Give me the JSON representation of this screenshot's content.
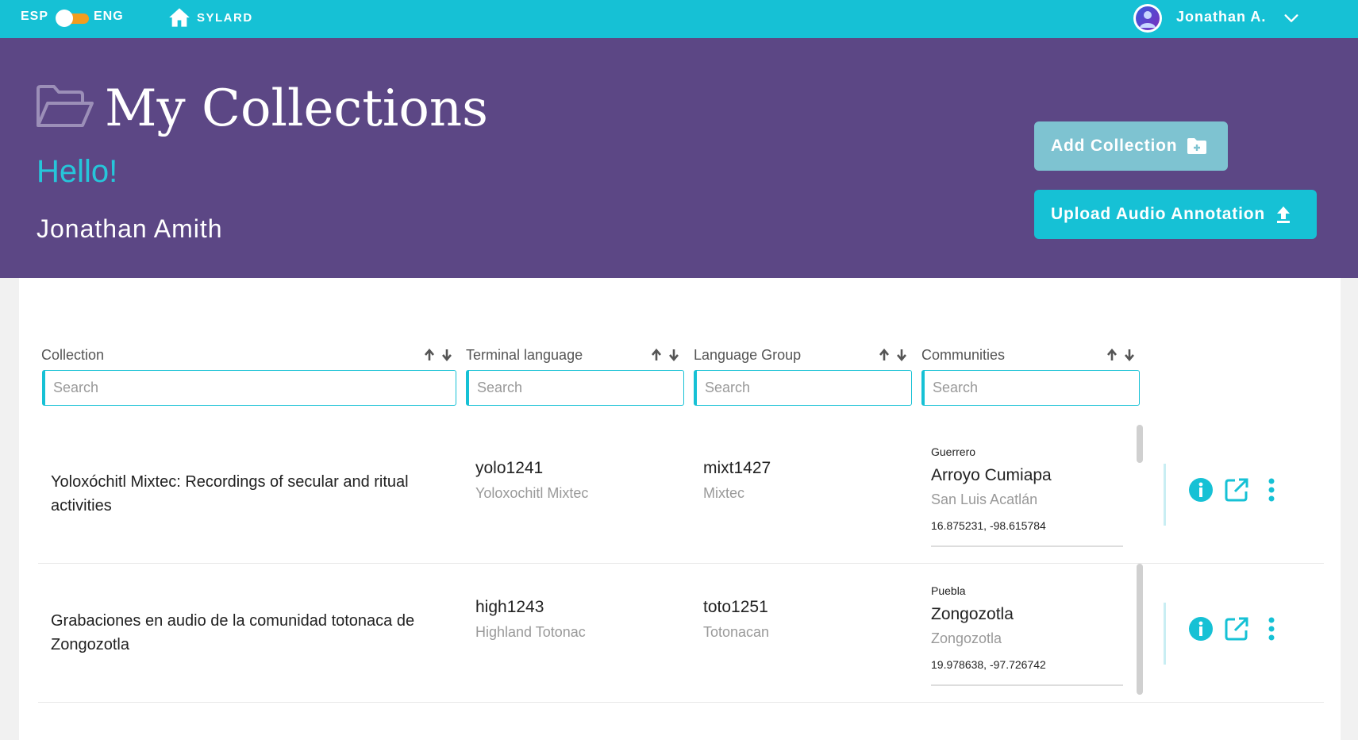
{
  "topbar": {
    "lang_left": "ESP",
    "lang_right": "ENG",
    "brand": "SYLARD",
    "user": "Jonathan A."
  },
  "hero": {
    "title": "My Collections",
    "greeting": "Hello!",
    "full_name": "Jonathan Amith",
    "add_button": "Add Collection",
    "upload_button": "Upload Audio Annotation"
  },
  "columns": [
    {
      "label": "Collection",
      "placeholder": "Search"
    },
    {
      "label": "Terminal language",
      "placeholder": "Search"
    },
    {
      "label": "Language Group",
      "placeholder": "Search"
    },
    {
      "label": "Communities",
      "placeholder": "Search"
    }
  ],
  "rows": [
    {
      "collection": "Yoloxóchitl Mixtec: Recordings of secular and ritual activities",
      "terminal_code": "yolo1241",
      "terminal_name": "Yoloxochitl Mixtec",
      "group_code": "mixt1427",
      "group_name": "Mixtec",
      "region": "Guerrero",
      "community": "Arroyo Cumiapa",
      "municipality": "San Luis Acatlán",
      "coords": "16.875231, -98.615784"
    },
    {
      "collection": "Grabaciones en audio de la comunidad totonaca de Zongozotla",
      "terminal_code": "high1243",
      "terminal_name": "Highland Totonac",
      "group_code": "toto1251",
      "group_name": "Totonacan",
      "region": "Puebla",
      "community": "Zongozotla",
      "municipality": "Zongozotla",
      "coords": "19.978638, -97.726742"
    }
  ],
  "icons": {
    "home": "home-icon",
    "user": "user-avatar-icon",
    "chevron": "chevron-down-icon",
    "folder": "folder-open-icon",
    "add": "folder-plus-icon",
    "upload": "upload-icon",
    "sort": "sort-arrows-icon",
    "info": "info-icon",
    "open": "open-external-icon",
    "more": "more-vertical-icon"
  },
  "colors": {
    "topbar": "#16c1d5",
    "hero": "#5c4785",
    "accent": "#26c6da",
    "add_button": "#7ec3d1",
    "upload_button": "#16c1d5",
    "toggle": "#f29d1f"
  }
}
